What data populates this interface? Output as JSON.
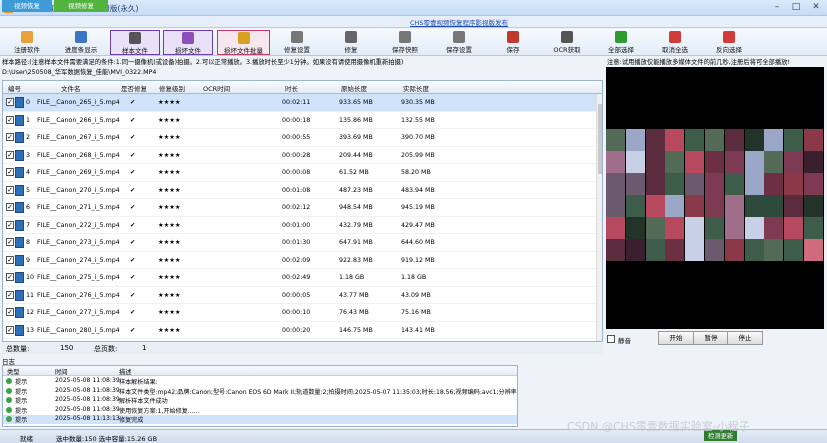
{
  "window": {
    "title": "CHS零壹视频恢复程序 高级版(永久)",
    "release_link": "CHS零壹视频恢复程序影视版发布"
  },
  "tabs": [
    {
      "label": "视频恢复"
    },
    {
      "label": "视频修复"
    }
  ],
  "toolbar": [
    {
      "label": "注册软件",
      "icon": "register-icon",
      "color": "#e8a23a"
    },
    {
      "label": "进度条显示",
      "icon": "progress-icon",
      "color": "#3a76c4"
    },
    {
      "label": "样本文件",
      "icon": "sample-file-icon",
      "color": "#555555"
    },
    {
      "label": "损坏文件",
      "icon": "damaged-file-icon",
      "color": "#8a4fb8"
    },
    {
      "label": "损坏文件批量",
      "icon": "damaged-batch-icon",
      "color": "#d6a022"
    },
    {
      "label": "修复设置",
      "icon": "repair-settings-icon",
      "color": "#777777"
    },
    {
      "label": "修复",
      "icon": "repair-icon",
      "color": "#666666"
    },
    {
      "label": "保存快照",
      "icon": "save-snapshot-icon",
      "color": "#777777"
    },
    {
      "label": "保存设置",
      "icon": "save-settings-icon",
      "color": "#777777"
    },
    {
      "label": "保存",
      "icon": "save-icon",
      "color": "#c0392b"
    },
    {
      "label": "OCR获取",
      "icon": "ocr-icon",
      "color": "#555555"
    },
    {
      "label": "全部选择",
      "icon": "check-all-icon",
      "color": "#2e9b2e"
    },
    {
      "label": "取消全选",
      "icon": "uncheck-all-icon",
      "color": "#d33a3a"
    },
    {
      "label": "反向选择",
      "icon": "invert-select-icon",
      "color": "#d33a3a"
    }
  ],
  "path_info": "样本路径:(注意样本文件需要满足的条件:1.同一摄像机(或设备)拍摄。2.可以正常播放。3.播放时长至少1分钟。如果没有请使用摄像机重新拍摄)",
  "file_path": "D:\\User\\250508_华军数据恢复_佳能\\MVI_0322.MP4",
  "table": {
    "columns": [
      "编号",
      "文件名",
      "是否修复",
      "修复级别",
      "OCR时间",
      "时长",
      "原始长度",
      "实际长度"
    ],
    "rows": [
      {
        "id": "0",
        "name": "FILE__Canon_265_i_5.mp4",
        "fixed": "✔",
        "level": "★★★★",
        "ocr": "",
        "duration": "00:02:11",
        "orig": "933.65 MB",
        "actual": "930.35 MB",
        "selected": true
      },
      {
        "id": "1",
        "name": "FILE__Canon_266_i_5.mp4",
        "fixed": "✔",
        "level": "★★★★",
        "ocr": "",
        "duration": "00:00:18",
        "orig": "135.86 MB",
        "actual": "132.55 MB"
      },
      {
        "id": "2",
        "name": "FILE__Canon_267_i_5.mp4",
        "fixed": "✔",
        "level": "★★★★",
        "ocr": "",
        "duration": "00:00:55",
        "orig": "393.69 MB",
        "actual": "390.70 MB"
      },
      {
        "id": "3",
        "name": "FILE__Canon_268_i_5.mp4",
        "fixed": "✔",
        "level": "★★★★",
        "ocr": "",
        "duration": "00:00:28",
        "orig": "209.44 MB",
        "actual": "205.99 MB"
      },
      {
        "id": "4",
        "name": "FILE__Canon_269_i_5.mp4",
        "fixed": "✔",
        "level": "★★★★",
        "ocr": "",
        "duration": "00:00:08",
        "orig": "61.52 MB",
        "actual": "58.20 MB"
      },
      {
        "id": "5",
        "name": "FILE__Canon_270_i_5.mp4",
        "fixed": "✔",
        "level": "★★★★",
        "ocr": "",
        "duration": "00:01:08",
        "orig": "487.23 MB",
        "actual": "483.94 MB"
      },
      {
        "id": "6",
        "name": "FILE__Canon_271_i_5.mp4",
        "fixed": "✔",
        "level": "★★★★",
        "ocr": "",
        "duration": "00:02:12",
        "orig": "948.54 MB",
        "actual": "945.19 MB"
      },
      {
        "id": "7",
        "name": "FILE__Canon_272_i_5.mp4",
        "fixed": "✔",
        "level": "★★★★",
        "ocr": "",
        "duration": "00:01:00",
        "orig": "432.79 MB",
        "actual": "429.47 MB"
      },
      {
        "id": "8",
        "name": "FILE__Canon_273_i_5.mp4",
        "fixed": "✔",
        "level": "★★★★",
        "ocr": "",
        "duration": "00:01:30",
        "orig": "647.91 MB",
        "actual": "644.60 MB"
      },
      {
        "id": "9",
        "name": "FILE__Canon_274_i_5.mp4",
        "fixed": "✔",
        "level": "★★★★",
        "ocr": "",
        "duration": "00:02:09",
        "orig": "922.83 MB",
        "actual": "919.12 MB"
      },
      {
        "id": "10",
        "name": "FILE__Canon_275_i_5.mp4",
        "fixed": "✔",
        "level": "★★★★",
        "ocr": "",
        "duration": "00:02:49",
        "orig": "1.18 GB",
        "actual": "1.18 GB"
      },
      {
        "id": "11",
        "name": "FILE__Canon_276_i_5.mp4",
        "fixed": "✔",
        "level": "★★★★",
        "ocr": "",
        "duration": "00:00:05",
        "orig": "43.77 MB",
        "actual": "43.09 MB"
      },
      {
        "id": "12",
        "name": "FILE__Canon_277_i_5.mp4",
        "fixed": "✔",
        "level": "★★★★",
        "ocr": "",
        "duration": "00:00:10",
        "orig": "76.43 MB",
        "actual": "75.16 MB"
      },
      {
        "id": "13",
        "name": "FILE__Canon_280_i_5.mp4",
        "fixed": "✔",
        "level": "★★★★",
        "ocr": "",
        "duration": "00:00:20",
        "orig": "146.75 MB",
        "actual": "143.41 MB"
      }
    ]
  },
  "counts": {
    "total_label": "总数量:",
    "total_value": "150",
    "pages_label": "总页数:",
    "pages_value": "1"
  },
  "preview": {
    "note": "注意:试用播放仅能播放多媒体文件的前几秒,注册后将可全部播放!",
    "mute_label": "静音",
    "start": "开始",
    "pause": "暂停",
    "stop": "停止"
  },
  "log": {
    "title": "日志",
    "columns": [
      "类型",
      "时间",
      "描述"
    ],
    "rows": [
      {
        "type": "提示",
        "time": "2025-05-08 11:08:39",
        "desc": "样本解析结果:"
      },
      {
        "type": "提示",
        "time": "2025-05-08 11:08:39",
        "desc": "样本文件类型:mp42;品牌:Canon;型号:Canon EOS 6D Mark II;轨道数量:2;拍摄时间:2025-05-07 11:35:03;时长:18.56;视频编码:avc1;分辨率:1"
      },
      {
        "type": "提示",
        "time": "2025-05-08 11:08:39",
        "desc": "解析样本文件成功"
      },
      {
        "type": "提示",
        "time": "2025-05-08 11:08:39",
        "desc": "使用恢复方案:1,开始修复......"
      },
      {
        "type": "提示",
        "time": "2025-05-08 11:13:13",
        "desc": "修复完成",
        "selected": true
      }
    ]
  },
  "status": {
    "ready": "就绪",
    "selected": "选中数量:150 选中容量:15.26 GB",
    "check_update": "检测更新"
  },
  "watermark": "CSDN @CHS零壹数据实验室-小程子"
}
